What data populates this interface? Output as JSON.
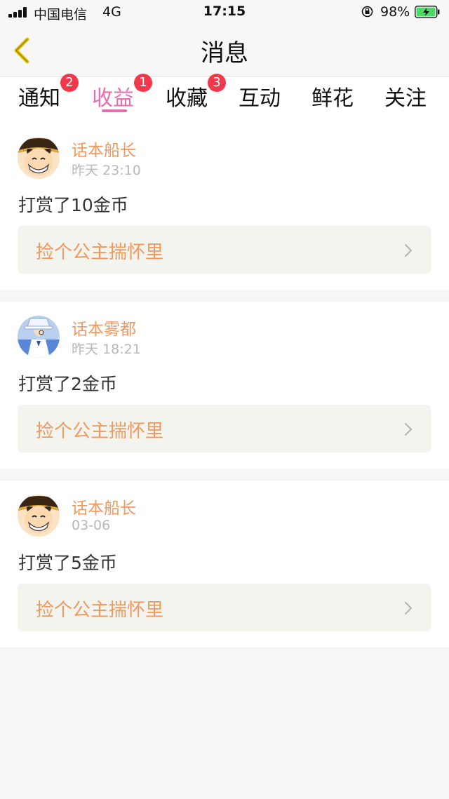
{
  "status_bar": {
    "carrier": "中国电信",
    "network": "4G",
    "time": "17:15",
    "battery": "98%",
    "battery_level": 0.98,
    "battery_color": "#4cd964"
  },
  "nav": {
    "back_icon": "chevron-left-icon",
    "title": "消息"
  },
  "tabs": [
    {
      "label": "通知",
      "badge": "2"
    },
    {
      "label": "收益",
      "badge": "1",
      "active": true
    },
    {
      "label": "收藏",
      "badge": "3"
    },
    {
      "label": "互动"
    },
    {
      "label": "鲜花"
    },
    {
      "label": "关注"
    }
  ],
  "theme": {
    "accent": "#e76db0",
    "username_color": "#f0985e",
    "badge_color": "#f2394a"
  },
  "messages": [
    {
      "user": "话本船长",
      "time": "昨天 23:10",
      "text": "打赏了10金币",
      "ref": "捡个公主揣怀里",
      "avatar": "luffy-avatar"
    },
    {
      "user": "话本雾都",
      "time": "昨天 18:21",
      "text": "打赏了2金币",
      "ref": "捡个公主揣怀里",
      "avatar": "kid-avatar"
    },
    {
      "user": "话本船长",
      "time": "03-06",
      "text": "打赏了5金币",
      "ref": "捡个公主揣怀里",
      "avatar": "luffy-avatar"
    }
  ]
}
